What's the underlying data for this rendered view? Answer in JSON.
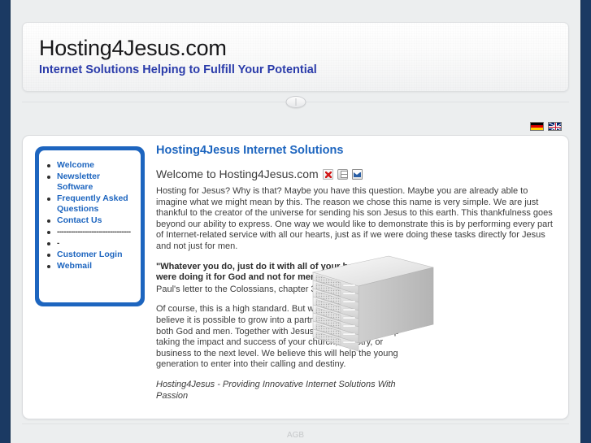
{
  "site": {
    "title": "Hosting4Jesus.com",
    "tagline": "Internet Solutions Helping to Fulfill Your Potential"
  },
  "languages": [
    {
      "name": "german",
      "label": "Deutsch"
    },
    {
      "name": "english",
      "label": "English"
    }
  ],
  "sidebar": {
    "items": [
      {
        "label": "Welcome"
      },
      {
        "label": "Newsletter Software"
      },
      {
        "label": "Frequently Asked Questions"
      },
      {
        "label": "Contact Us"
      },
      {
        "label": "--------------------------------"
      },
      {
        "label": "-"
      },
      {
        "label": "Customer Login"
      },
      {
        "label": "Webmail"
      }
    ]
  },
  "article": {
    "title": "Hosting4Jesus Internet Solutions",
    "subtitle": "Welcome to Hosting4Jesus.com",
    "actions": [
      {
        "name": "pdf-icon",
        "label": "PDF"
      },
      {
        "name": "print-icon",
        "label": "Print"
      },
      {
        "name": "email-icon",
        "label": "E-mail"
      }
    ],
    "paragraph1": "Hosting for Jesus? Why is that? Maybe you have this question. Maybe you are already able to imagine what we might mean by this. The reason we chose this name is very simple. We are just thankful to the creator of the universe for sending his son Jesus to this earth. This thankfulness goes beyond our ability to express. One way we would like to demonstrate this is by performing every part of Internet-related service with all our hearts, just as if we were doing these tasks directly for Jesus and not just for men.",
    "quote": "\"Whatever you do, just do it with all of your heart as if you were doing it for God and not for men.\"",
    "quote_source": "Paul's letter to the Colossians, chapter 3, verse 23",
    "paragraph2": "Of course, this is a high standard. But we enjoy challenges and believe it is possible to grow into a partnership of this kind with both God and men. Together with Jesus we would like to help taking the impact and success of your church, ministry, or business to the next level. We believe this will help the young generation to enter into their calling and destiny.",
    "signature": "Hosting4Jesus - Providing Innovative Internet Solutions With Passion"
  },
  "footer": {
    "link": "AGB"
  },
  "colors": {
    "page_background": "#1b3a63",
    "accent_blue": "#1d65bf",
    "tagline_blue": "#2b3cab",
    "panel_background": "#ffffff",
    "frame_background": "#eceeef"
  }
}
